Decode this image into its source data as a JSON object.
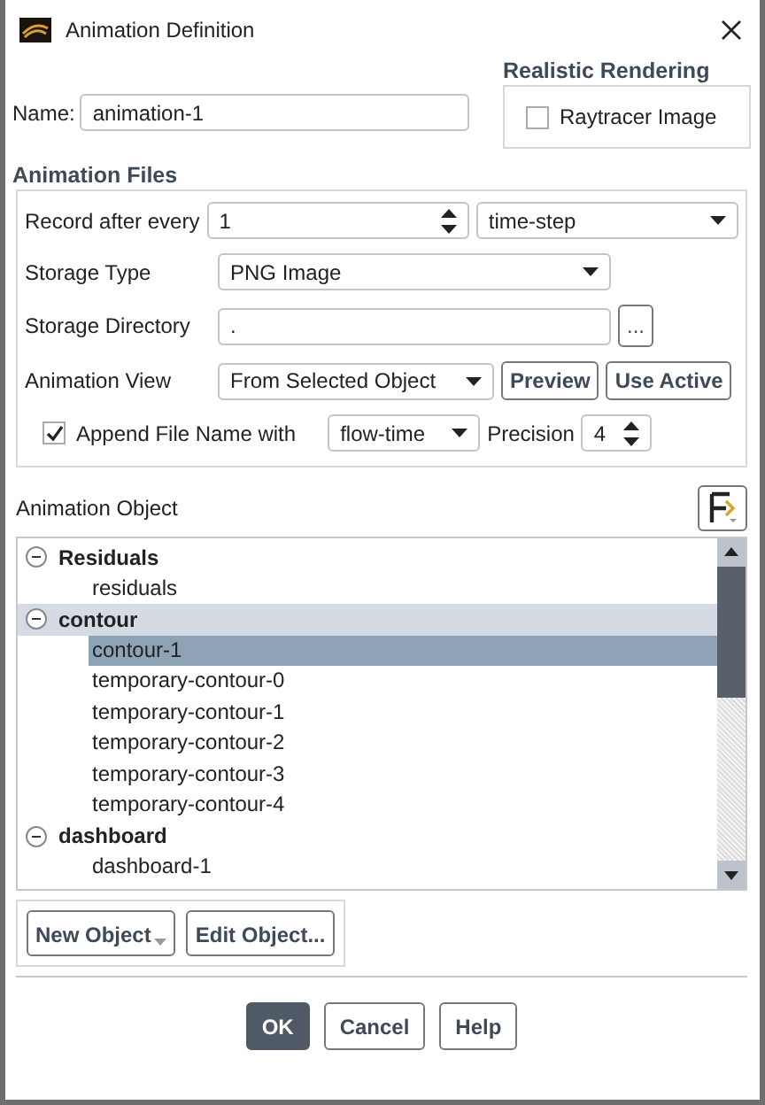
{
  "window": {
    "title": "Animation Definition"
  },
  "name_field": {
    "label": "Name:",
    "value": "animation-1"
  },
  "realistic_rendering": {
    "title": "Realistic Rendering",
    "raytracer": {
      "label": "Raytracer Image",
      "checked": false
    }
  },
  "animation_files": {
    "title": "Animation Files",
    "record": {
      "label": "Record after every",
      "value": "1",
      "unit": "time-step"
    },
    "storage_type": {
      "label": "Storage Type",
      "value": "PNG Image"
    },
    "storage_directory": {
      "label": "Storage Directory",
      "value": ".",
      "browse": "..."
    },
    "animation_view": {
      "label": "Animation View",
      "value": "From Selected Object",
      "buttons": [
        "Preview",
        "Use Active"
      ]
    },
    "append": {
      "label": "Append File Name with",
      "checked": true,
      "value": "flow-time",
      "precision_label": "Precision",
      "precision": "4"
    }
  },
  "animation_object": {
    "label": "Animation Object",
    "tree": [
      {
        "label": "Residuals",
        "expanded": true,
        "selected": false,
        "children": [
          {
            "label": "residuals",
            "selected": false
          }
        ]
      },
      {
        "label": "contour",
        "expanded": true,
        "selected": true,
        "children": [
          {
            "label": "contour-1",
            "selected": true
          },
          {
            "label": "temporary-contour-0",
            "selected": false
          },
          {
            "label": "temporary-contour-1",
            "selected": false
          },
          {
            "label": "temporary-contour-2",
            "selected": false
          },
          {
            "label": "temporary-contour-3",
            "selected": false
          },
          {
            "label": "temporary-contour-4",
            "selected": false
          }
        ]
      },
      {
        "label": "dashboard",
        "expanded": true,
        "selected": false,
        "children": [
          {
            "label": "dashboard-1",
            "selected": false
          }
        ]
      }
    ],
    "buttons": [
      "New Object",
      "Edit Object..."
    ]
  },
  "buttons": [
    {
      "label": "OK",
      "kind": "primary"
    },
    {
      "label": "Cancel",
      "kind": "normal"
    },
    {
      "label": "Help",
      "kind": "normal"
    }
  ]
}
